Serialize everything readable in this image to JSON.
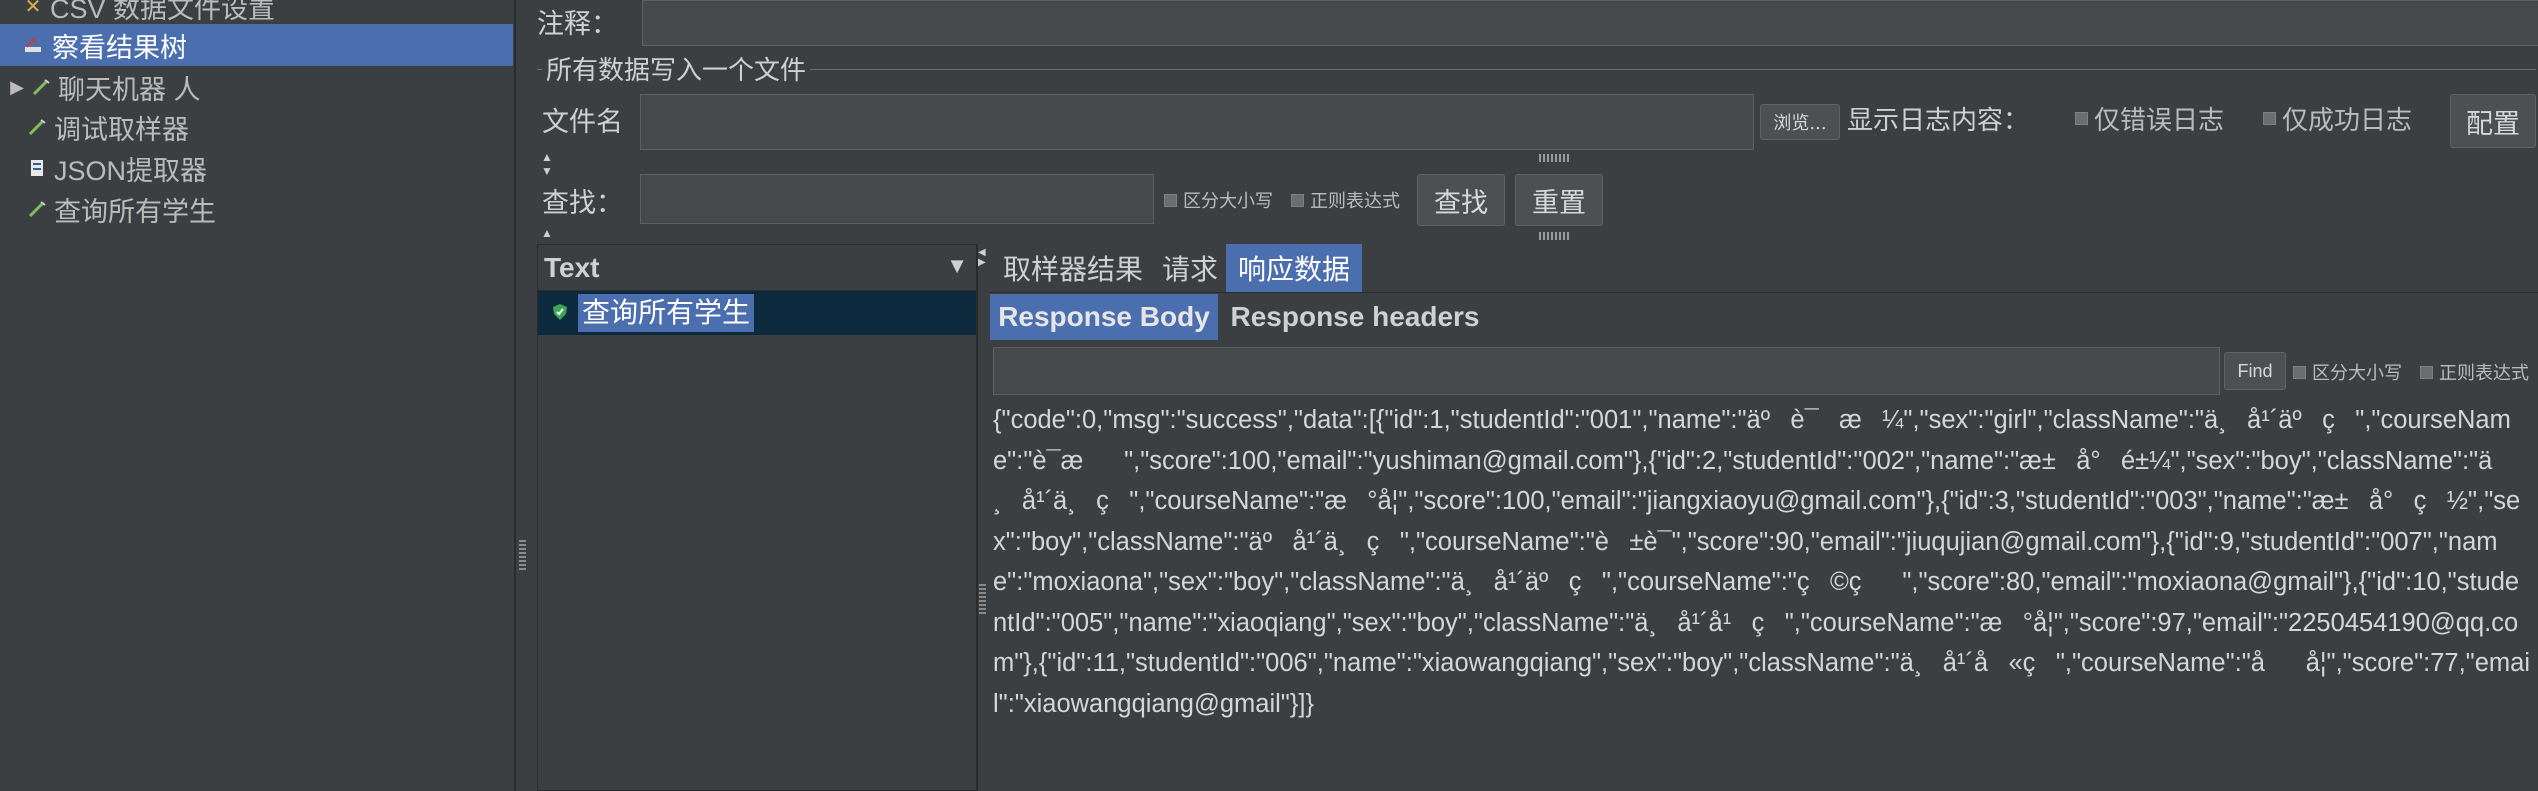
{
  "tree": {
    "items": [
      {
        "label": "CSV 数据文件设置",
        "icon": "csv-icon"
      },
      {
        "label": "察看结果树",
        "icon": "listener-icon",
        "selected": true
      },
      {
        "label": "聊天机器 人",
        "icon": "sampler-icon"
      },
      {
        "label": "调试取样器",
        "icon": "sampler-icon"
      },
      {
        "label": "JSON提取器",
        "icon": "extractor-icon"
      },
      {
        "label": "查询所有学生",
        "icon": "sampler-icon"
      }
    ]
  },
  "form": {
    "comment_label": "注释：",
    "file_section_title": "所有数据写入一个文件",
    "filename_label": "文件名",
    "browse_label": "浏览...",
    "log_label": "显示日志内容：",
    "errors_only_label": "仅错误日志",
    "success_only_label": "仅成功日志",
    "config_label": "配置"
  },
  "search": {
    "label": "查找：",
    "case_label": "区分大小写",
    "regex_label": "正则表达式",
    "find_label": "查找",
    "reset_label": "重置"
  },
  "results": {
    "column_header": "Text",
    "items": [
      {
        "label": "查询所有学生"
      }
    ]
  },
  "tabs": {
    "sampler_result": "取样器结果",
    "request": "请求",
    "response_data": "响应数据"
  },
  "subtabs": {
    "body": "Response Body",
    "headers": "Response headers"
  },
  "response_search": {
    "find_label": "Find",
    "case_label": "区分大小写",
    "regex_label": "正则表达式"
  },
  "response_body": "{\"code\":0,\"msg\":\"success\",\"data\":[{\"id\":1,\"studentId\":\"001\",\"name\":\"äºè¯æ¼\",\"sex\":\"girl\",\"className\":\"ä¸å¹´äºç­\",\"courseName\":\"è¯­æ\",\"score\":100,\"email\":\"yushiman@gmail.com\"},{\"id\":2,\"studentId\":\"002\",\"name\":\"æ±å°é±¼\",\"sex\":\"boy\",\"className\":\"ä¸å¹´ä¸ç­\",\"courseName\":\"æ°å­¦\",\"score\":100,\"email\":\"jiangxiaoyu@gmail.com\"},{\"id\":3,\"studentId\":\"003\",\"name\":\"æ±å°ç½\",\"sex\":\"boy\",\"className\":\"äºå¹´ä¸ç­\",\"courseName\":\"è±è¯­\",\"score\":90,\"email\":\"jiuqujian@gmail.com\"},{\"id\":9,\"studentId\":\"007\",\"name\":\"moxiaona\",\"sex\":\"boy\",\"className\":\"ä¸å¹´äºç­\",\"courseName\":\"ç©ç\",\"score\":80,\"email\":\"moxiaona@gmail\"},{\"id\":10,\"studentId\":\"005\",\"name\":\"xiaoqiang\",\"sex\":\"boy\",\"className\":\"ä¸å¹´å¹ç­\",\"courseName\":\"æ°å­¦\",\"score\":97,\"email\":\"2250454190@qq.com\"},{\"id\":11,\"studentId\":\"006\",\"name\":\"xiaowangqiang\",\"sex\":\"boy\",\"className\":\"ä¸å¹´å«ç­\",\"courseName\":\"åå­¦\",\"score\":77,\"email\":\"xiaowangqiang@gmail\"}]}"
}
